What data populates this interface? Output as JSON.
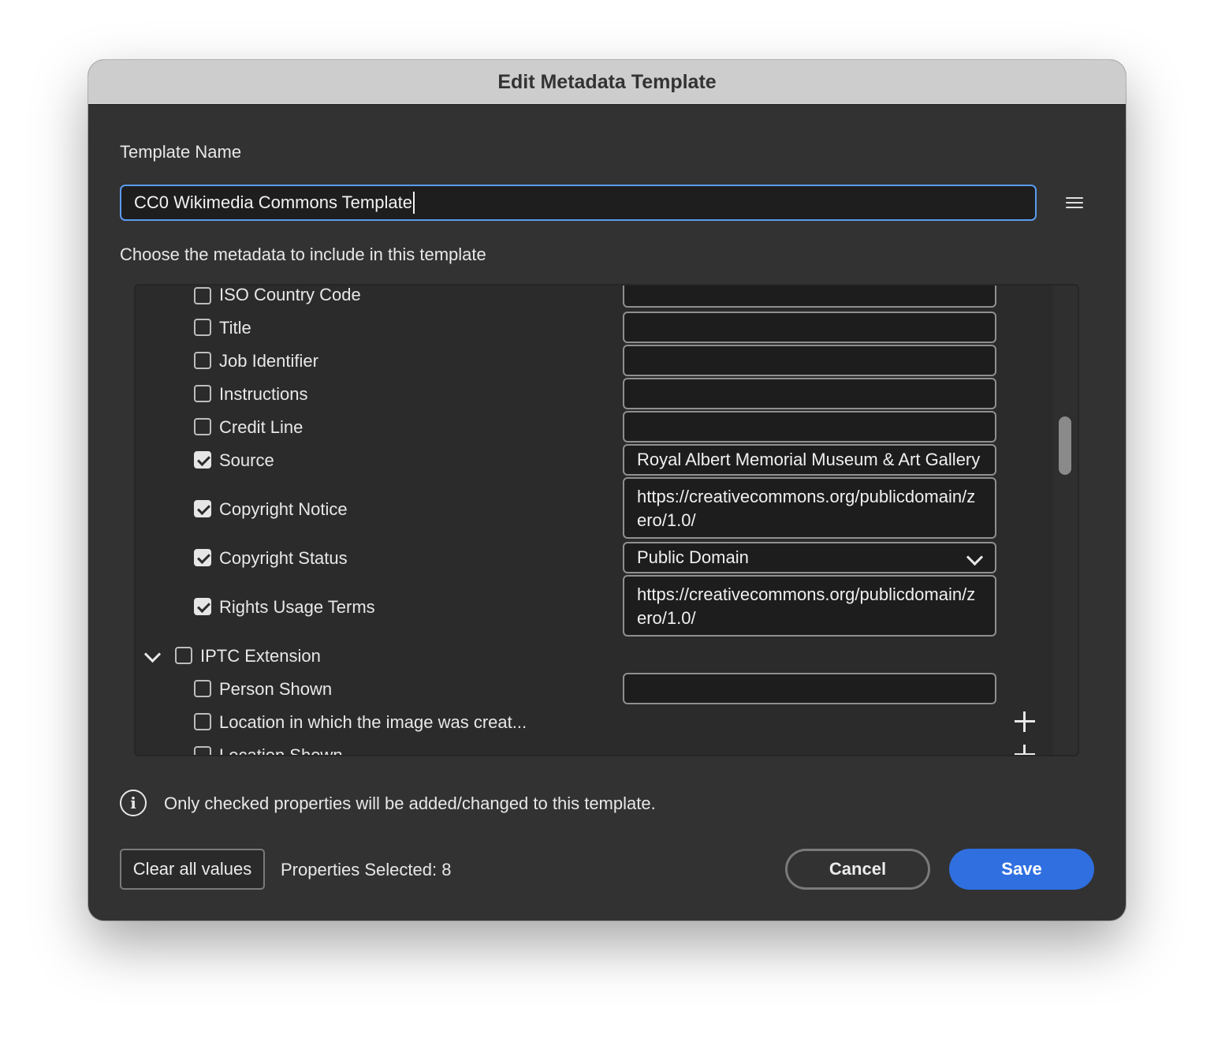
{
  "dialog": {
    "title": "Edit Metadata Template",
    "template_name_label": "Template Name",
    "template_name_value": "CC0 Wikimedia Commons Template",
    "choose_label": "Choose the metadata to include in this template",
    "info_text": "Only checked properties will be added/changed to this template.",
    "properties_selected": "Properties Selected: 8",
    "buttons": {
      "clear": "Clear all values",
      "cancel": "Cancel",
      "save": "Save"
    }
  },
  "rows": {
    "iso_country_code": {
      "label": "ISO Country Code",
      "checked": false,
      "value": ""
    },
    "title": {
      "label": "Title",
      "checked": false,
      "value": ""
    },
    "job_identifier": {
      "label": "Job Identifier",
      "checked": false,
      "value": ""
    },
    "instructions": {
      "label": "Instructions",
      "checked": false,
      "value": ""
    },
    "credit_line": {
      "label": "Credit Line",
      "checked": false,
      "value": ""
    },
    "source": {
      "label": "Source",
      "checked": true,
      "value": "Royal Albert Memorial Museum & Art Gallery"
    },
    "copyright_notice": {
      "label": "Copyright Notice",
      "checked": true,
      "value": "https://creativecommons.org/publicdomain/zero/1.0/"
    },
    "copyright_status": {
      "label": "Copyright Status",
      "checked": true,
      "value": "Public Domain"
    },
    "rights_usage_terms": {
      "label": "Rights Usage Terms",
      "checked": true,
      "value": "https://creativecommons.org/publicdomain/zero/1.0/"
    },
    "iptc_extension": {
      "label": "IPTC Extension",
      "checked": false,
      "expanded": true
    },
    "person_shown": {
      "label": "Person Shown",
      "checked": false,
      "value": ""
    },
    "location_created": {
      "label": "Location in which the image was creat...",
      "checked": false
    },
    "location_shown": {
      "label": "Location Shown",
      "checked": false
    }
  },
  "icons": {
    "menu": "hamburger-menu-icon",
    "info": "info-icon",
    "add": "plus-icon",
    "dropdown": "chevron-down-icon"
  },
  "colors": {
    "accent": "#2f6fe0",
    "focus_ring": "#5b9bf2",
    "background": "#323232"
  }
}
